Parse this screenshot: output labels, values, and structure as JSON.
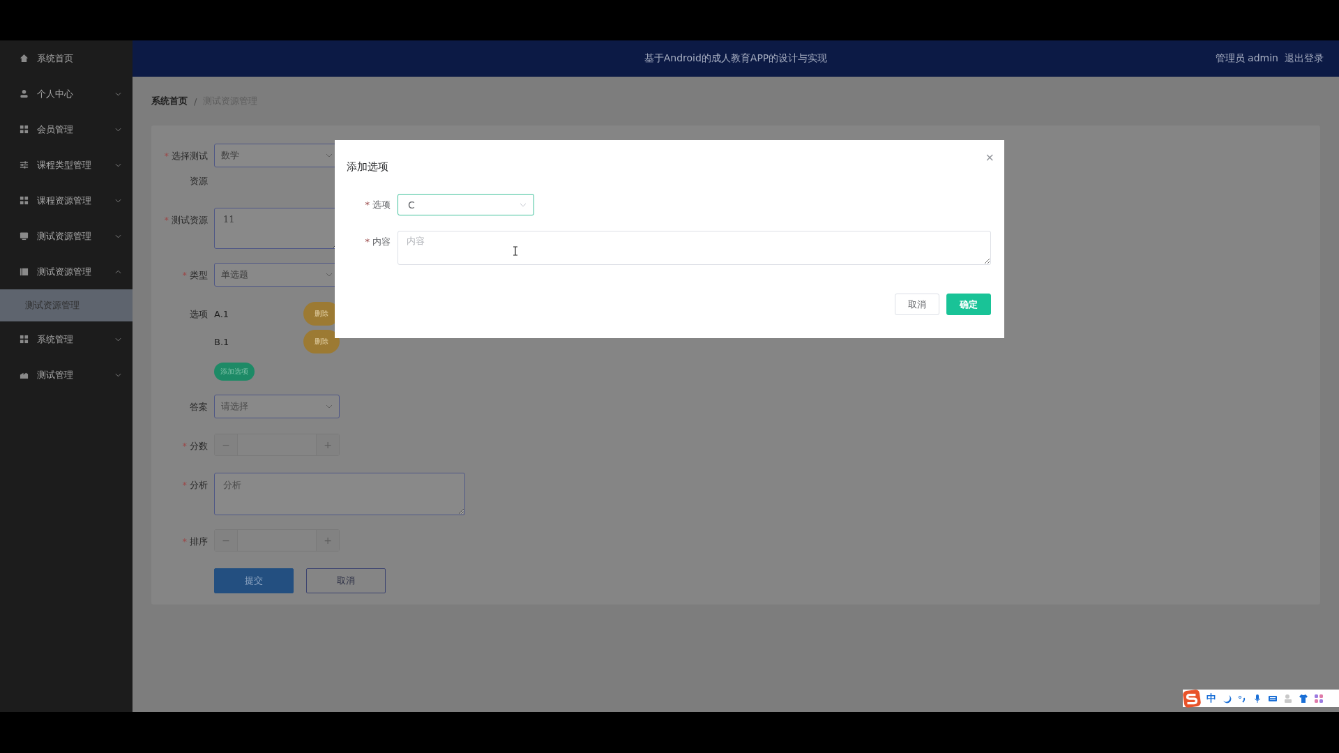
{
  "header": {
    "title": "基于Android的成人教育APP的设计与实现",
    "user": "管理员 admin",
    "logout": "退出登录"
  },
  "sidebar": {
    "items": [
      {
        "label": "系统首页"
      },
      {
        "label": "个人中心",
        "expanded": false
      },
      {
        "label": "会员管理",
        "expanded": false
      },
      {
        "label": "课程类型管理",
        "expanded": false
      },
      {
        "label": "课程资源管理",
        "expanded": false
      },
      {
        "label": "测试资源管理",
        "expanded": false
      },
      {
        "label": "测试资源管理",
        "expanded": true,
        "children": [
          {
            "label": "测试资源管理",
            "selected": true
          }
        ]
      },
      {
        "label": "系统管理",
        "expanded": false
      },
      {
        "label": "测试管理",
        "expanded": false
      }
    ]
  },
  "breadcrumb": {
    "items": [
      "系统首页",
      "测试资源管理"
    ],
    "separator": "/"
  },
  "form": {
    "required_mark": "*",
    "fields": [
      {
        "kind": "select",
        "label": "选择测试资源",
        "required": true,
        "value": "数学"
      },
      {
        "kind": "textarea",
        "label": "测试资源",
        "required": true,
        "value": "11"
      },
      {
        "kind": "select",
        "label": "类型",
        "required": true,
        "value": "单选题"
      },
      {
        "kind": "options",
        "label": "选项",
        "required": false,
        "items": [
          {
            "text": "A.1",
            "button": "删除"
          },
          {
            "text": "B.1",
            "button": "删除"
          }
        ],
        "add_button": "添加选项"
      },
      {
        "kind": "select",
        "label": "答案",
        "required": false,
        "placeholder": "请选择"
      },
      {
        "kind": "number",
        "label": "分数",
        "required": true,
        "minus": "−",
        "plus": "+"
      },
      {
        "kind": "textarea",
        "label": "分析",
        "required": true,
        "placeholder": "分析",
        "wide": true
      },
      {
        "kind": "number",
        "label": "排序",
        "required": true,
        "minus": "−",
        "plus": "+"
      }
    ],
    "actions": [
      {
        "label": "提交",
        "kind": "primary"
      },
      {
        "label": "取消",
        "kind": "default"
      }
    ]
  },
  "dialog": {
    "title": "添加选项",
    "close": "×",
    "required_mark": "*",
    "fields": [
      {
        "kind": "select",
        "label": "选项",
        "value": "C"
      },
      {
        "kind": "textarea",
        "label": "内容",
        "placeholder": "内容"
      }
    ],
    "buttons": [
      {
        "label": "取消",
        "kind": "default"
      },
      {
        "label": "确定",
        "kind": "primary"
      }
    ]
  },
  "ime_toolbar": {
    "label": "中"
  }
}
